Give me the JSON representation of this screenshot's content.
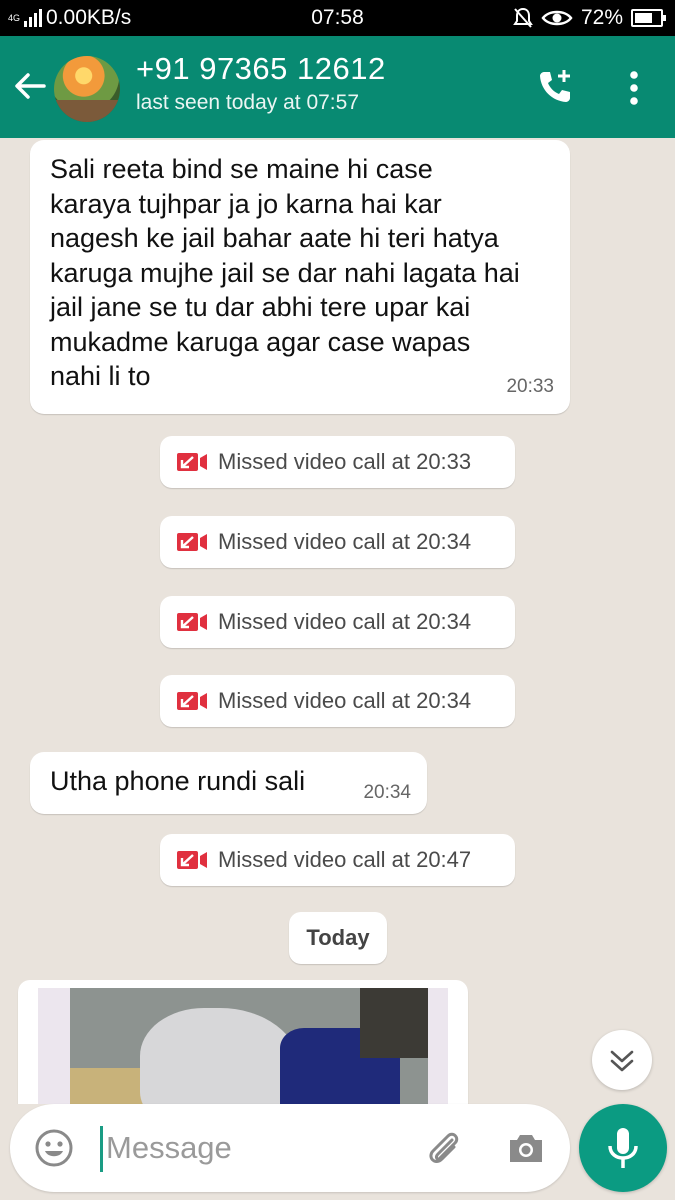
{
  "status_bar": {
    "network_type": "4G",
    "data_speed": "0.00KB/s",
    "time": "07:58",
    "battery": "72%",
    "battery_level": 0.72
  },
  "header": {
    "contact_name": "+91 97365 12612",
    "last_seen": "last seen today at 07:57"
  },
  "messages": {
    "msg1": {
      "text": "Sali reeta bind se maine hi case karaya tujhpar ja jo karna hai kar nagesh ke jail bahar aate hi teri hatya karuga mujhe jail se dar nahi lagata hai jail jane se tu dar abhi tere upar kai mukadme karuga agar case wapas nahi li to",
      "time": "20:33"
    },
    "missed_calls": [
      "Missed video call at 20:33",
      "Missed video call at 20:34",
      "Missed video call at 20:34",
      "Missed video call at 20:34"
    ],
    "msg2": {
      "text": "Utha phone rundi sali",
      "time": "20:34"
    },
    "missed_call_last": "Missed video call at 20:47",
    "date_divider": "Today"
  },
  "input": {
    "placeholder": "Message"
  },
  "colors": {
    "header": "#088a72",
    "accent": "#0b9b82",
    "missed_call_red": "#e0303f",
    "chat_bg": "#e9e3dc"
  },
  "icons": {
    "back": "back-arrow-icon",
    "call": "add-call-icon",
    "menu": "more-vertical-icon",
    "missed": "missed-video-call-icon",
    "emoji": "emoji-icon",
    "attach": "paperclip-icon",
    "camera": "camera-icon",
    "mic": "mic-icon",
    "scroll": "double-chevron-down-icon"
  }
}
